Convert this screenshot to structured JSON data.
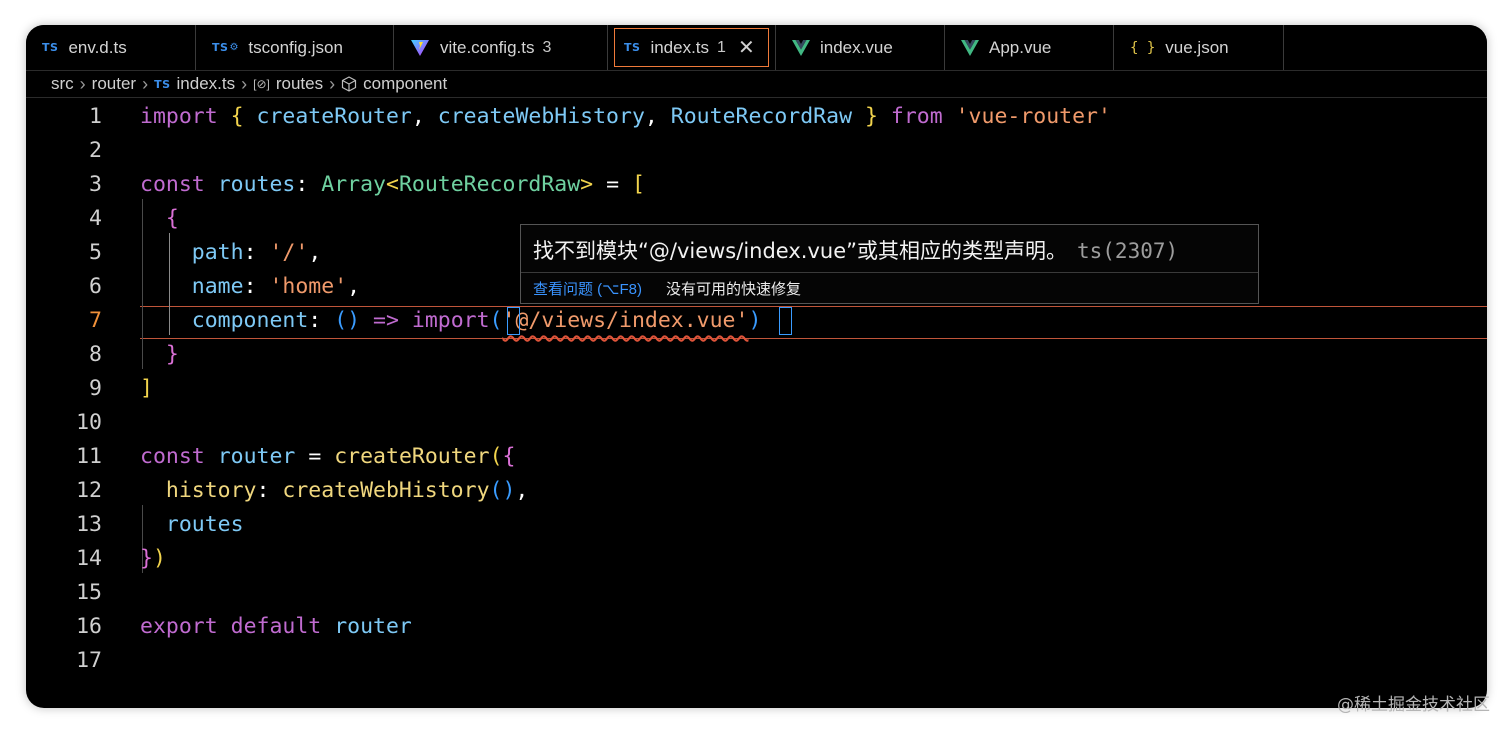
{
  "tabs": [
    {
      "label": "env.d.ts",
      "icon": "typescript-icon",
      "badge": ""
    },
    {
      "label": "tsconfig.json",
      "icon": "typescript-config-icon",
      "badge": ""
    },
    {
      "label": "vite.config.ts",
      "icon": "vite-icon",
      "badge": "3"
    },
    {
      "label": "index.ts",
      "icon": "typescript-icon",
      "badge": "1",
      "active": true
    },
    {
      "label": "index.vue",
      "icon": "vue-icon",
      "badge": ""
    },
    {
      "label": "App.vue",
      "icon": "vue-icon",
      "badge": ""
    },
    {
      "label": "vue.json",
      "icon": "json-icon",
      "badge": ""
    }
  ],
  "icon_text": {
    "ts": "TS",
    "json": "{ }",
    "close": "✕",
    "sep": "›",
    "var": "[⊘]"
  },
  "breadcrumb": [
    "src",
    "router",
    "index.ts",
    "routes",
    "component"
  ],
  "line_numbers": [
    "1",
    "2",
    "3",
    "4",
    "5",
    "6",
    "7",
    "8",
    "9",
    "10",
    "11",
    "12",
    "13",
    "14",
    "15",
    "16",
    "17"
  ],
  "current_line": 7,
  "code": {
    "l1": {
      "import": "import",
      "ob": "{",
      "a": "createRouter",
      "c1": ",",
      "b": "createWebHistory",
      "c2": ",",
      "c": "RouteRecordRaw",
      "cb": "}",
      "from": "from",
      "mod": "'vue-router'"
    },
    "l3": {
      "const": "const",
      "name": "routes",
      "colon": ":",
      "type": "Array",
      "lt": "<",
      "arg": "RouteRecordRaw",
      "gt": ">",
      "eq": "=",
      "ob": "["
    },
    "l4": {
      "ob": "{"
    },
    "l5": {
      "key": "path",
      "colon": ":",
      "val": "'/'",
      "comma": ","
    },
    "l6": {
      "key": "name",
      "colon": ":",
      "val": "'home'",
      "comma": ","
    },
    "l7": {
      "key": "component",
      "colon": ":",
      "parens": "()",
      "arrow": "=>",
      "import": "import",
      "op": "(",
      "path": "'@/views/index.vue'",
      "cp": ")"
    },
    "l8": {
      "cb": "}"
    },
    "l9": {
      "cb": "]"
    },
    "l11": {
      "const": "const",
      "name": "router",
      "eq": "=",
      "fn": "createRouter",
      "op": "(",
      "ob": "{"
    },
    "l12": {
      "key": "history",
      "colon": ":",
      "fn": "createWebHistory",
      "parens": "()",
      "comma": ","
    },
    "l13": {
      "key": "routes"
    },
    "l14": {
      "cb": "}",
      "cp": ")"
    },
    "l16": {
      "export": "export",
      "default": "default",
      "name": "router"
    }
  },
  "hover": {
    "message": "找不到模块“@/views/index.vue”或其相应的类型声明。",
    "code": "ts(2307)",
    "view_problem": "查看问题 (⌥F8)",
    "no_fix": "没有可用的快速修复"
  },
  "watermark": "@稀土掘金技术社区",
  "colors": {
    "keyword": "#c06bd0",
    "function": "#f0d77e",
    "type": "#6fd1a0",
    "identifier": "#7ec9f5",
    "string": "#f09a6b",
    "active_tab_border": "#f07a3a",
    "link": "#3a94ff"
  }
}
